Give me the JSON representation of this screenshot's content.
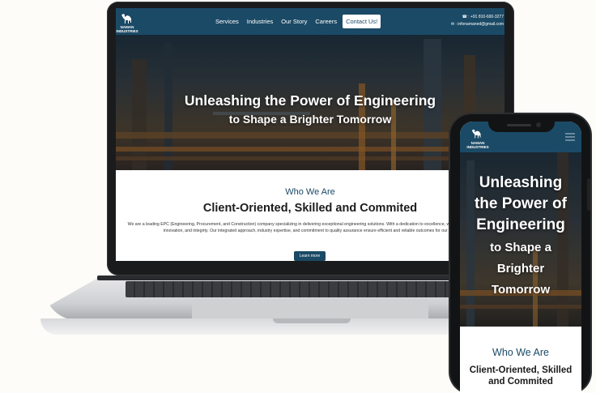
{
  "brand": {
    "logo_text": "NAMAN INDUSTRIES"
  },
  "nav": {
    "links": [
      "Services",
      "Industries",
      "Our Story",
      "Careers"
    ],
    "contact_button": "Contact Us!",
    "phone": "+91 810-600-3277",
    "email": "infonamaned@gmail.com"
  },
  "hero": {
    "line1": "Unleashing the Power of Engineering",
    "line2": "to Shape a Brighter Tomorrow"
  },
  "phone_hero": {
    "lines": [
      "Unleashing",
      "the Power of",
      "Engineering",
      "to Shape a",
      "Brighter",
      "Tomorrow"
    ]
  },
  "about": {
    "eyebrow": "Who We Are",
    "heading": "Client-Oriented, Skilled and Commited",
    "description": "We are a leading EPC (Engineering, Procurement, and Construction) company specializing in delivering exceptional engineering solutions. With a dedication to excellence, we prioritize client success, innovation, and integrity. Our integrated approach, industry expertise, and commitment to quality assurance ensure efficient and reliable outcomes for our clients.",
    "button": "Learn more"
  },
  "phone_about": {
    "eyebrow": "Who We Are",
    "heading_line1": "Client-Oriented, Skilled",
    "heading_line2": "and Commited"
  },
  "colors": {
    "brand_blue": "#1b4a66",
    "background": "#fdfcf8"
  }
}
